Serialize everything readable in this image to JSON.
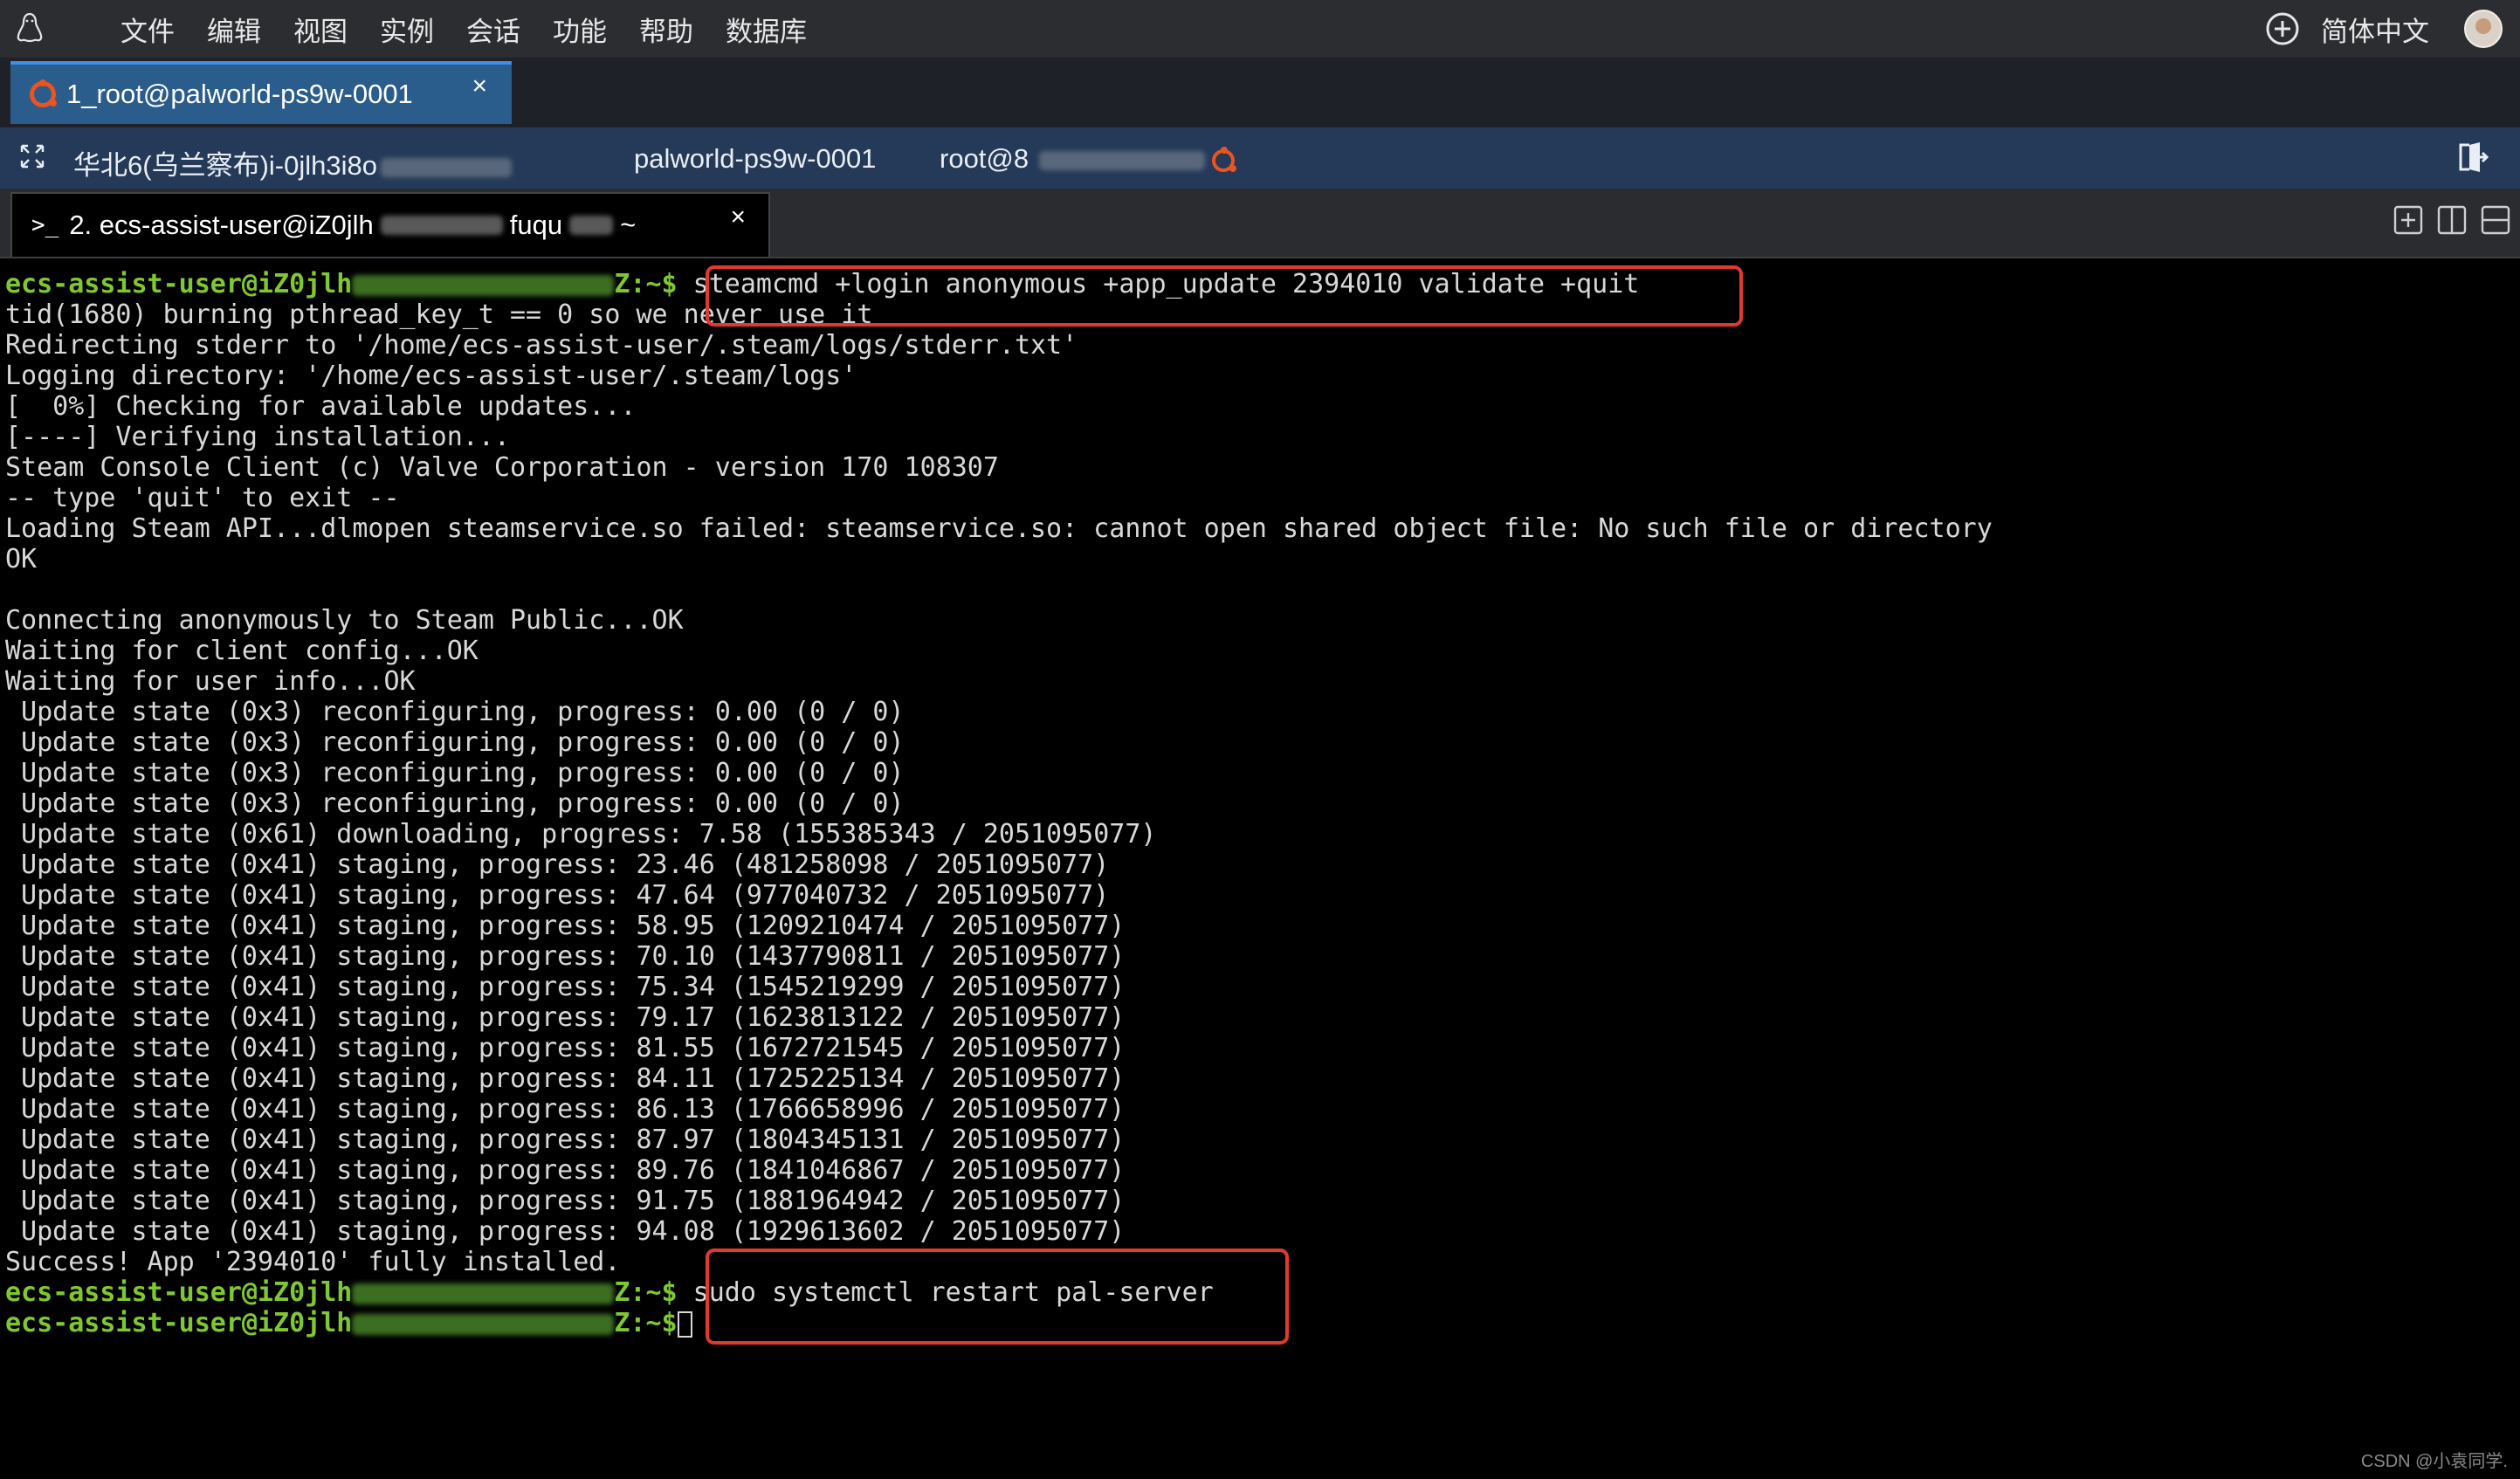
{
  "menubar": {
    "items": [
      "文件",
      "编辑",
      "视图",
      "实例",
      "会话",
      "功能",
      "帮助",
      "数据库"
    ],
    "language": "简体中文"
  },
  "session_tab": {
    "title": "1_root@palworld-ps9w-0001",
    "close": "×"
  },
  "infobar": {
    "region": "华北6(乌兰察布)i-0jlh3i8o",
    "host": "palworld-ps9w-0001",
    "user_prefix": "root@8"
  },
  "terminal_tab": {
    "title": "2. ecs-assist-user@iZ0jlh",
    "suffix": "fuqu",
    "tilde": "~",
    "close": "×"
  },
  "terminal": {
    "prompt_user": "ecs-assist-user@iZ0jlh",
    "prompt_tail": "Z:~$",
    "cmd1": " steamcmd +login anonymous +app_update 2394010 validate +quit",
    "line_tid": "tid(1680) burning pthread_key_t == 0 so we never use it",
    "lines": [
      "Redirecting stderr to '/home/ecs-assist-user/.steam/logs/stderr.txt'",
      "Logging directory: '/home/ecs-assist-user/.steam/logs'",
      "[  0%] Checking for available updates...",
      "[----] Verifying installation...",
      "Steam Console Client (c) Valve Corporation - version 170 108307",
      "-- type 'quit' to exit --",
      "Loading Steam API...dlmopen steamservice.so failed: steamservice.so: cannot open shared object file: No such file or directory",
      "OK",
      "",
      "Connecting anonymously to Steam Public...OK",
      "Waiting for client config...OK",
      "Waiting for user info...OK",
      " Update state (0x3) reconfiguring, progress: 0.00 (0 / 0)",
      " Update state (0x3) reconfiguring, progress: 0.00 (0 / 0)",
      " Update state (0x3) reconfiguring, progress: 0.00 (0 / 0)",
      " Update state (0x3) reconfiguring, progress: 0.00 (0 / 0)",
      " Update state (0x61) downloading, progress: 7.58 (155385343 / 2051095077)",
      " Update state (0x41) staging, progress: 23.46 (481258098 / 2051095077)",
      " Update state (0x41) staging, progress: 47.64 (977040732 / 2051095077)",
      " Update state (0x41) staging, progress: 58.95 (1209210474 / 2051095077)",
      " Update state (0x41) staging, progress: 70.10 (1437790811 / 2051095077)",
      " Update state (0x41) staging, progress: 75.34 (1545219299 / 2051095077)",
      " Update state (0x41) staging, progress: 79.17 (1623813122 / 2051095077)",
      " Update state (0x41) staging, progress: 81.55 (1672721545 / 2051095077)",
      " Update state (0x41) staging, progress: 84.11 (1725225134 / 2051095077)",
      " Update state (0x41) staging, progress: 86.13 (1766658996 / 2051095077)",
      " Update state (0x41) staging, progress: 87.97 (1804345131 / 2051095077)",
      " Update state (0x41) staging, progress: 89.76 (1841046867 / 2051095077)",
      " Update state (0x41) staging, progress: 91.75 (1881964942 / 2051095077)",
      " Update state (0x41) staging, progress: 94.08 (1929613602 / 2051095077)",
      "Success! App '2394010' fully installed."
    ],
    "cmd2": " sudo systemctl restart pal-server"
  },
  "watermark": "CSDN @小袁同学.",
  "colors": {
    "prompt_green": "#7ec832",
    "highlight_red": "#e03a2f",
    "tab_blue": "#2a5d8c"
  }
}
